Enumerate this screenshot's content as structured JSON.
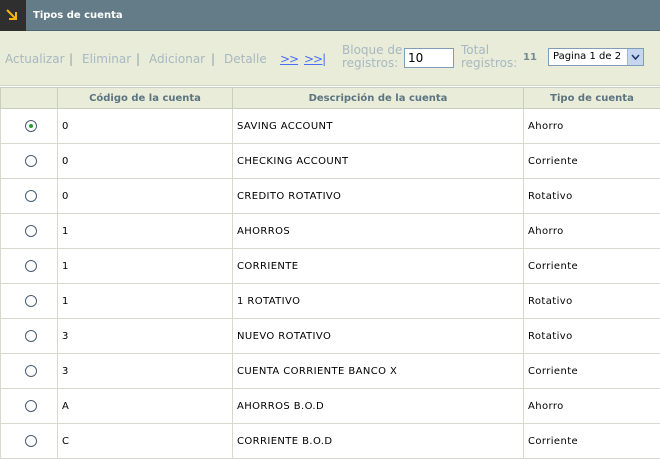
{
  "window": {
    "title": "Tipos de cuenta",
    "icon": "expand-arrow-icon"
  },
  "toolbar": {
    "actualizar": "Actualizar",
    "eliminar": "Eliminar",
    "adicionar": "Adicionar",
    "detalle": "Detalle",
    "separator": "|",
    "next_label": ">>",
    "last_label": ">>|",
    "block_label_line1": "Bloque de",
    "block_label_line2": "registros:",
    "block_value": "10",
    "total_label_line1": "Total",
    "total_label_line2": "registros:",
    "total_value": "11",
    "page_select_value": "Pagina 1 de 2"
  },
  "table": {
    "columns": [
      "",
      "Código de la cuenta",
      "Descripción de la cuenta",
      "Tipo de cuenta"
    ],
    "rows": [
      {
        "selected": true,
        "codigo": "0",
        "descripcion": "SAVING ACCOUNT",
        "tipo": "Ahorro"
      },
      {
        "selected": false,
        "codigo": "0",
        "descripcion": "CHECKING ACCOUNT",
        "tipo": "Corriente"
      },
      {
        "selected": false,
        "codigo": "0",
        "descripcion": "CREDITO ROTATIVO",
        "tipo": "Rotativo"
      },
      {
        "selected": false,
        "codigo": "1",
        "descripcion": "AHORROS",
        "tipo": "Ahorro"
      },
      {
        "selected": false,
        "codigo": "1",
        "descripcion": "CORRIENTE",
        "tipo": "Corriente"
      },
      {
        "selected": false,
        "codigo": "1",
        "descripcion": "1 ROTATIVO",
        "tipo": "Rotativo"
      },
      {
        "selected": false,
        "codigo": "3",
        "descripcion": "NUEVO ROTATIVO",
        "tipo": "Rotativo"
      },
      {
        "selected": false,
        "codigo": "3",
        "descripcion": "CUENTA CORRIENTE BANCO X",
        "tipo": "Corriente"
      },
      {
        "selected": false,
        "codigo": "A",
        "descripcion": "AHORROS B.O.D",
        "tipo": "Ahorro"
      },
      {
        "selected": false,
        "codigo": "C",
        "descripcion": "CORRIENTE B.O.D",
        "tipo": "Corriente"
      }
    ]
  }
}
